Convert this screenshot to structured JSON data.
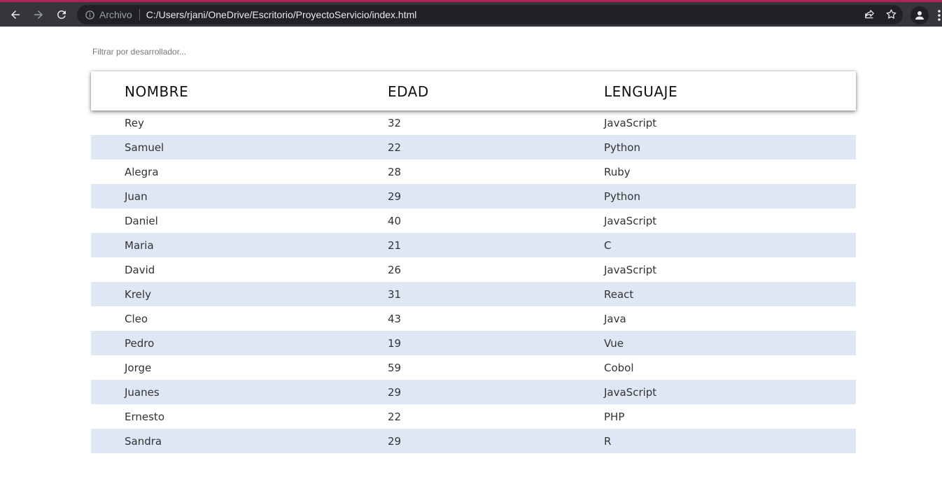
{
  "browser": {
    "scheme_label": "Archivo",
    "url": "C:/Users/rjani/OneDrive/Escritorio/ProyectoServicio/index.html"
  },
  "filter": {
    "placeholder": "Filtrar por desarrollador..."
  },
  "table": {
    "headers": [
      "NOMBRE",
      "EDAD",
      "LENGUAJE"
    ],
    "rows": [
      [
        "Rey",
        "32",
        "JavaScript"
      ],
      [
        "Samuel",
        "22",
        "Python"
      ],
      [
        "Alegra",
        "28",
        "Ruby"
      ],
      [
        "Juan",
        "29",
        "Python"
      ],
      [
        "Daniel",
        "40",
        "JavaScript"
      ],
      [
        "Maria",
        "21",
        "C"
      ],
      [
        "David",
        "26",
        "JavaScript"
      ],
      [
        "Krely",
        "31",
        "React"
      ],
      [
        "Cleo",
        "43",
        "Java"
      ],
      [
        "Pedro",
        "19",
        "Vue"
      ],
      [
        "Jorge",
        "59",
        "Cobol"
      ],
      [
        "Juanes",
        "29",
        "JavaScript"
      ],
      [
        "Ernesto",
        "22",
        "PHP"
      ],
      [
        "Sandra",
        "29",
        "R"
      ]
    ]
  },
  "colors": {
    "accent_strip": "#b0235d",
    "stripe_row": "#dee7f3"
  }
}
